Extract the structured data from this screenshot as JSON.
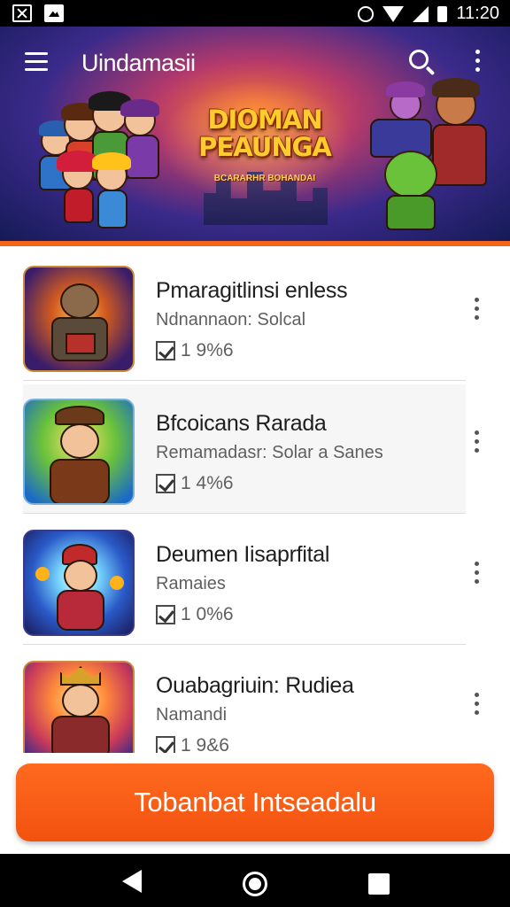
{
  "status_bar": {
    "time": "11:20",
    "icons": [
      "notification-x-icon",
      "image-icon",
      "alarm-icon",
      "wifi-icon",
      "signal-icon",
      "battery-icon"
    ]
  },
  "header": {
    "app_title": "Uindamasii",
    "menu_icon": "hamburger-menu-icon",
    "search_icon": "search-icon",
    "overflow_icon": "more-vertical-icon"
  },
  "banner": {
    "title": "DIOMAN PEAUNGA",
    "subtitle": "BCARARHR BOHANDAI",
    "page_count": 5,
    "active_page": 1,
    "accent_color": "#f2651a"
  },
  "list": {
    "items": [
      {
        "title": "Pmaragitlinsi enless",
        "subtitle": "Ndnannaon: Solcal",
        "count": "1 9%6"
      },
      {
        "title": "Bfcoicans Rarada",
        "subtitle": "Remamadasr: Solar a Sanes",
        "count": "1 4%6"
      },
      {
        "title": "Deumen Iisaprfital",
        "subtitle": "Ramaies",
        "count": "1 0%6"
      },
      {
        "title": "Ouabagriuin: Rudiea",
        "subtitle": "Namandi",
        "count": "1 9&6"
      }
    ]
  },
  "cta": {
    "label": "Tobanbat Intseadalu",
    "color": "#f2580f"
  },
  "nav_bar": {
    "icons": [
      "back-icon",
      "home-icon",
      "recents-icon"
    ]
  }
}
